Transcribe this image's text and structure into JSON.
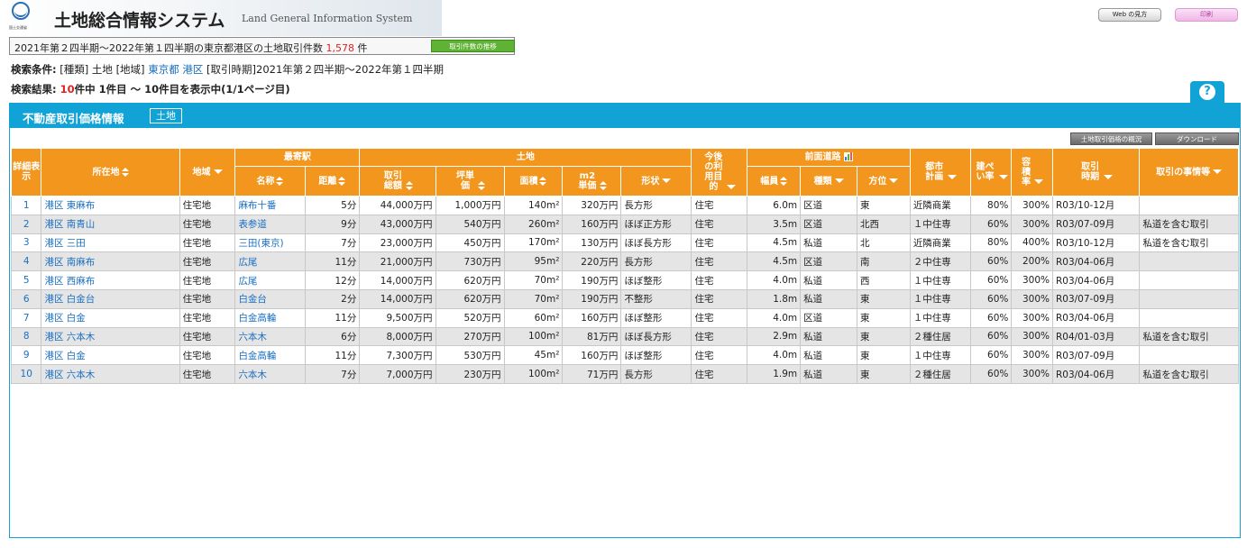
{
  "header": {
    "logo_text": "国土交通省",
    "title": "土地総合情報システム",
    "subtitle": "Land General Information System",
    "web_btn": "Web の見方",
    "print_btn": "印刷"
  },
  "summary": {
    "text": "2021年第２四半期～2022年第１四半期の東京都港区の土地取引件数",
    "count": "1,578",
    "unit": "件",
    "trend_btn": "取引件数の推移"
  },
  "conditions": {
    "label": "検索条件:",
    "type_tag": "[種類]",
    "type": "土地",
    "area_tag": "[地域]",
    "pref": "東京都",
    "ward": "港区",
    "period_tag": "[取引時期]",
    "period": "2021年第２四半期～2022年第１四半期"
  },
  "result": {
    "label": "検索結果:",
    "total": "10",
    "rest": "件中 1件目 ～ 10件目を表示中(1/1ページ目)"
  },
  "panel": {
    "title": "不動産取引価格情報",
    "tag": "土地",
    "btn_overview": "土地取引価格の概況",
    "btn_download": "ダウンロード"
  },
  "columns": {
    "detail": "詳細表示",
    "location": "所在地",
    "district": "地域",
    "station_group": "最寄駅",
    "station_name": "名称",
    "distance": "距離",
    "land_group": "土地",
    "total_price": "取引総額",
    "tsubo_price": "坪単価",
    "area": "面積",
    "m2_price": "m2単価",
    "shape": "形状",
    "future_use": "今後の利用目的",
    "road_group": "前面道路",
    "road_width": "幅員",
    "road_type": "種類",
    "road_dir": "方位",
    "city_plan": "都市計画",
    "coverage": "建ぺい率",
    "far": "容積率",
    "period": "取引時期",
    "notes": "取引の事情等"
  },
  "rows": [
    {
      "no": "1",
      "loc": "港区 東麻布",
      "district": "住宅地",
      "station": "麻布十番",
      "dist": "5分",
      "total": "44,000万円",
      "tsubo": "1,000万円",
      "area": "140m²",
      "m2": "320万円",
      "shape": "長方形",
      "use": "住宅",
      "width": "6.0m",
      "rtype": "区道",
      "dir": "東",
      "plan": "近隣商業",
      "cov": "80%",
      "far": "300%",
      "period": "R03/10-12月",
      "notes": ""
    },
    {
      "no": "2",
      "loc": "港区 南青山",
      "district": "住宅地",
      "station": "表参道",
      "dist": "9分",
      "total": "43,000万円",
      "tsubo": "540万円",
      "area": "260m²",
      "m2": "160万円",
      "shape": "ほぼ正方形",
      "use": "住宅",
      "width": "3.5m",
      "rtype": "区道",
      "dir": "北西",
      "plan": "１中住専",
      "cov": "60%",
      "far": "300%",
      "period": "R03/07-09月",
      "notes": "私道を含む取引"
    },
    {
      "no": "3",
      "loc": "港区 三田",
      "district": "住宅地",
      "station": "三田(東京)",
      "dist": "7分",
      "total": "23,000万円",
      "tsubo": "450万円",
      "area": "170m²",
      "m2": "130万円",
      "shape": "ほぼ長方形",
      "use": "住宅",
      "width": "4.5m",
      "rtype": "私道",
      "dir": "北",
      "plan": "近隣商業",
      "cov": "80%",
      "far": "400%",
      "period": "R03/10-12月",
      "notes": "私道を含む取引"
    },
    {
      "no": "4",
      "loc": "港区 南麻布",
      "district": "住宅地",
      "station": "広尾",
      "dist": "11分",
      "total": "21,000万円",
      "tsubo": "730万円",
      "area": "95m²",
      "m2": "220万円",
      "shape": "長方形",
      "use": "住宅",
      "width": "4.5m",
      "rtype": "区道",
      "dir": "南",
      "plan": "２中住専",
      "cov": "60%",
      "far": "200%",
      "period": "R03/04-06月",
      "notes": ""
    },
    {
      "no": "5",
      "loc": "港区 西麻布",
      "district": "住宅地",
      "station": "広尾",
      "dist": "12分",
      "total": "14,000万円",
      "tsubo": "620万円",
      "area": "70m²",
      "m2": "190万円",
      "shape": "ほぼ整形",
      "use": "住宅",
      "width": "4.0m",
      "rtype": "私道",
      "dir": "西",
      "plan": "１中住専",
      "cov": "60%",
      "far": "300%",
      "period": "R03/04-06月",
      "notes": ""
    },
    {
      "no": "6",
      "loc": "港区 白金台",
      "district": "住宅地",
      "station": "白金台",
      "dist": "2分",
      "total": "14,000万円",
      "tsubo": "620万円",
      "area": "70m²",
      "m2": "190万円",
      "shape": "不整形",
      "use": "住宅",
      "width": "1.8m",
      "rtype": "私道",
      "dir": "東",
      "plan": "１中住専",
      "cov": "60%",
      "far": "300%",
      "period": "R03/07-09月",
      "notes": ""
    },
    {
      "no": "7",
      "loc": "港区 白金",
      "district": "住宅地",
      "station": "白金高輪",
      "dist": "11分",
      "total": "9,500万円",
      "tsubo": "520万円",
      "area": "60m²",
      "m2": "160万円",
      "shape": "ほぼ整形",
      "use": "住宅",
      "width": "4.0m",
      "rtype": "区道",
      "dir": "東",
      "plan": "１中住専",
      "cov": "60%",
      "far": "300%",
      "period": "R03/04-06月",
      "notes": ""
    },
    {
      "no": "8",
      "loc": "港区 六本木",
      "district": "住宅地",
      "station": "六本木",
      "dist": "6分",
      "total": "8,000万円",
      "tsubo": "270万円",
      "area": "100m²",
      "m2": "81万円",
      "shape": "ほぼ長方形",
      "use": "住宅",
      "width": "2.9m",
      "rtype": "私道",
      "dir": "東",
      "plan": "２種住居",
      "cov": "60%",
      "far": "300%",
      "period": "R04/01-03月",
      "notes": "私道を含む取引"
    },
    {
      "no": "9",
      "loc": "港区 白金",
      "district": "住宅地",
      "station": "白金高輪",
      "dist": "11分",
      "total": "7,300万円",
      "tsubo": "530万円",
      "area": "45m²",
      "m2": "160万円",
      "shape": "ほぼ整形",
      "use": "住宅",
      "width": "4.0m",
      "rtype": "私道",
      "dir": "東",
      "plan": "１中住専",
      "cov": "60%",
      "far": "300%",
      "period": "R03/07-09月",
      "notes": ""
    },
    {
      "no": "10",
      "loc": "港区 六本木",
      "district": "住宅地",
      "station": "六本木",
      "dist": "7分",
      "total": "7,000万円",
      "tsubo": "230万円",
      "area": "100m²",
      "m2": "71万円",
      "shape": "長方形",
      "use": "住宅",
      "width": "1.9m",
      "rtype": "私道",
      "dir": "東",
      "plan": "２種住居",
      "cov": "60%",
      "far": "300%",
      "period": "R03/04-06月",
      "notes": "私道を含む取引"
    }
  ]
}
